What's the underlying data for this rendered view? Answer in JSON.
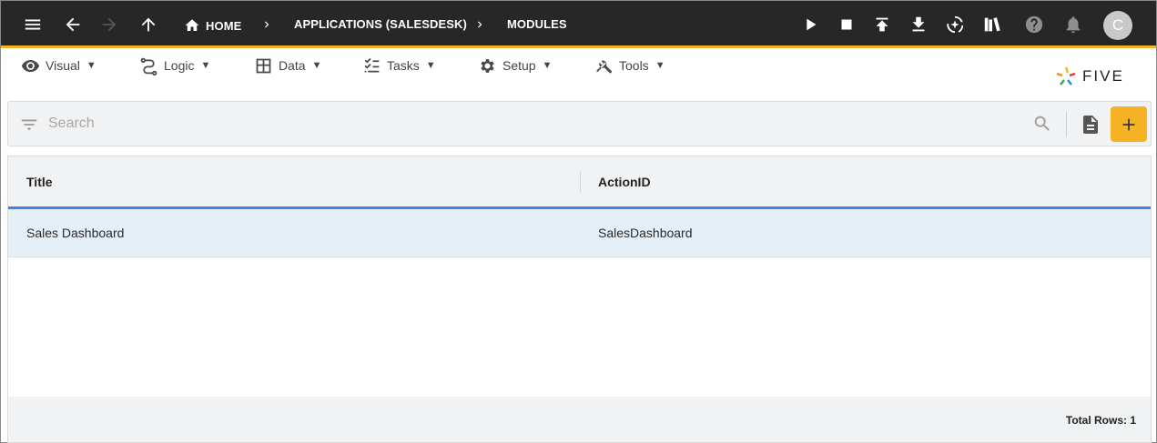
{
  "topbar": {
    "breadcrumbs": [
      {
        "label": "HOME"
      },
      {
        "label": "APPLICATIONS (SALESDESK)"
      },
      {
        "label": "MODULES"
      }
    ],
    "avatar_initial": "C"
  },
  "menu": {
    "items": [
      {
        "label": "Visual",
        "icon": "eye-icon"
      },
      {
        "label": "Logic",
        "icon": "logic-icon"
      },
      {
        "label": "Data",
        "icon": "table-icon"
      },
      {
        "label": "Tasks",
        "icon": "checklist-icon"
      },
      {
        "label": "Setup",
        "icon": "gear-icon"
      },
      {
        "label": "Tools",
        "icon": "tools-icon"
      }
    ],
    "caret": "▼"
  },
  "logo": {
    "text": "FIVE"
  },
  "search": {
    "placeholder": "Search",
    "value": ""
  },
  "table": {
    "columns": [
      "Title",
      "ActionID"
    ],
    "rows": [
      {
        "title": "Sales Dashboard",
        "action_id": "SalesDashboard"
      }
    ],
    "footer": "Total Rows: 1"
  },
  "colors": {
    "topbar_bg": "#272727",
    "accent": "#f5b323",
    "selected_row": "#e5eff8",
    "header_underline": "#3d86d8"
  }
}
